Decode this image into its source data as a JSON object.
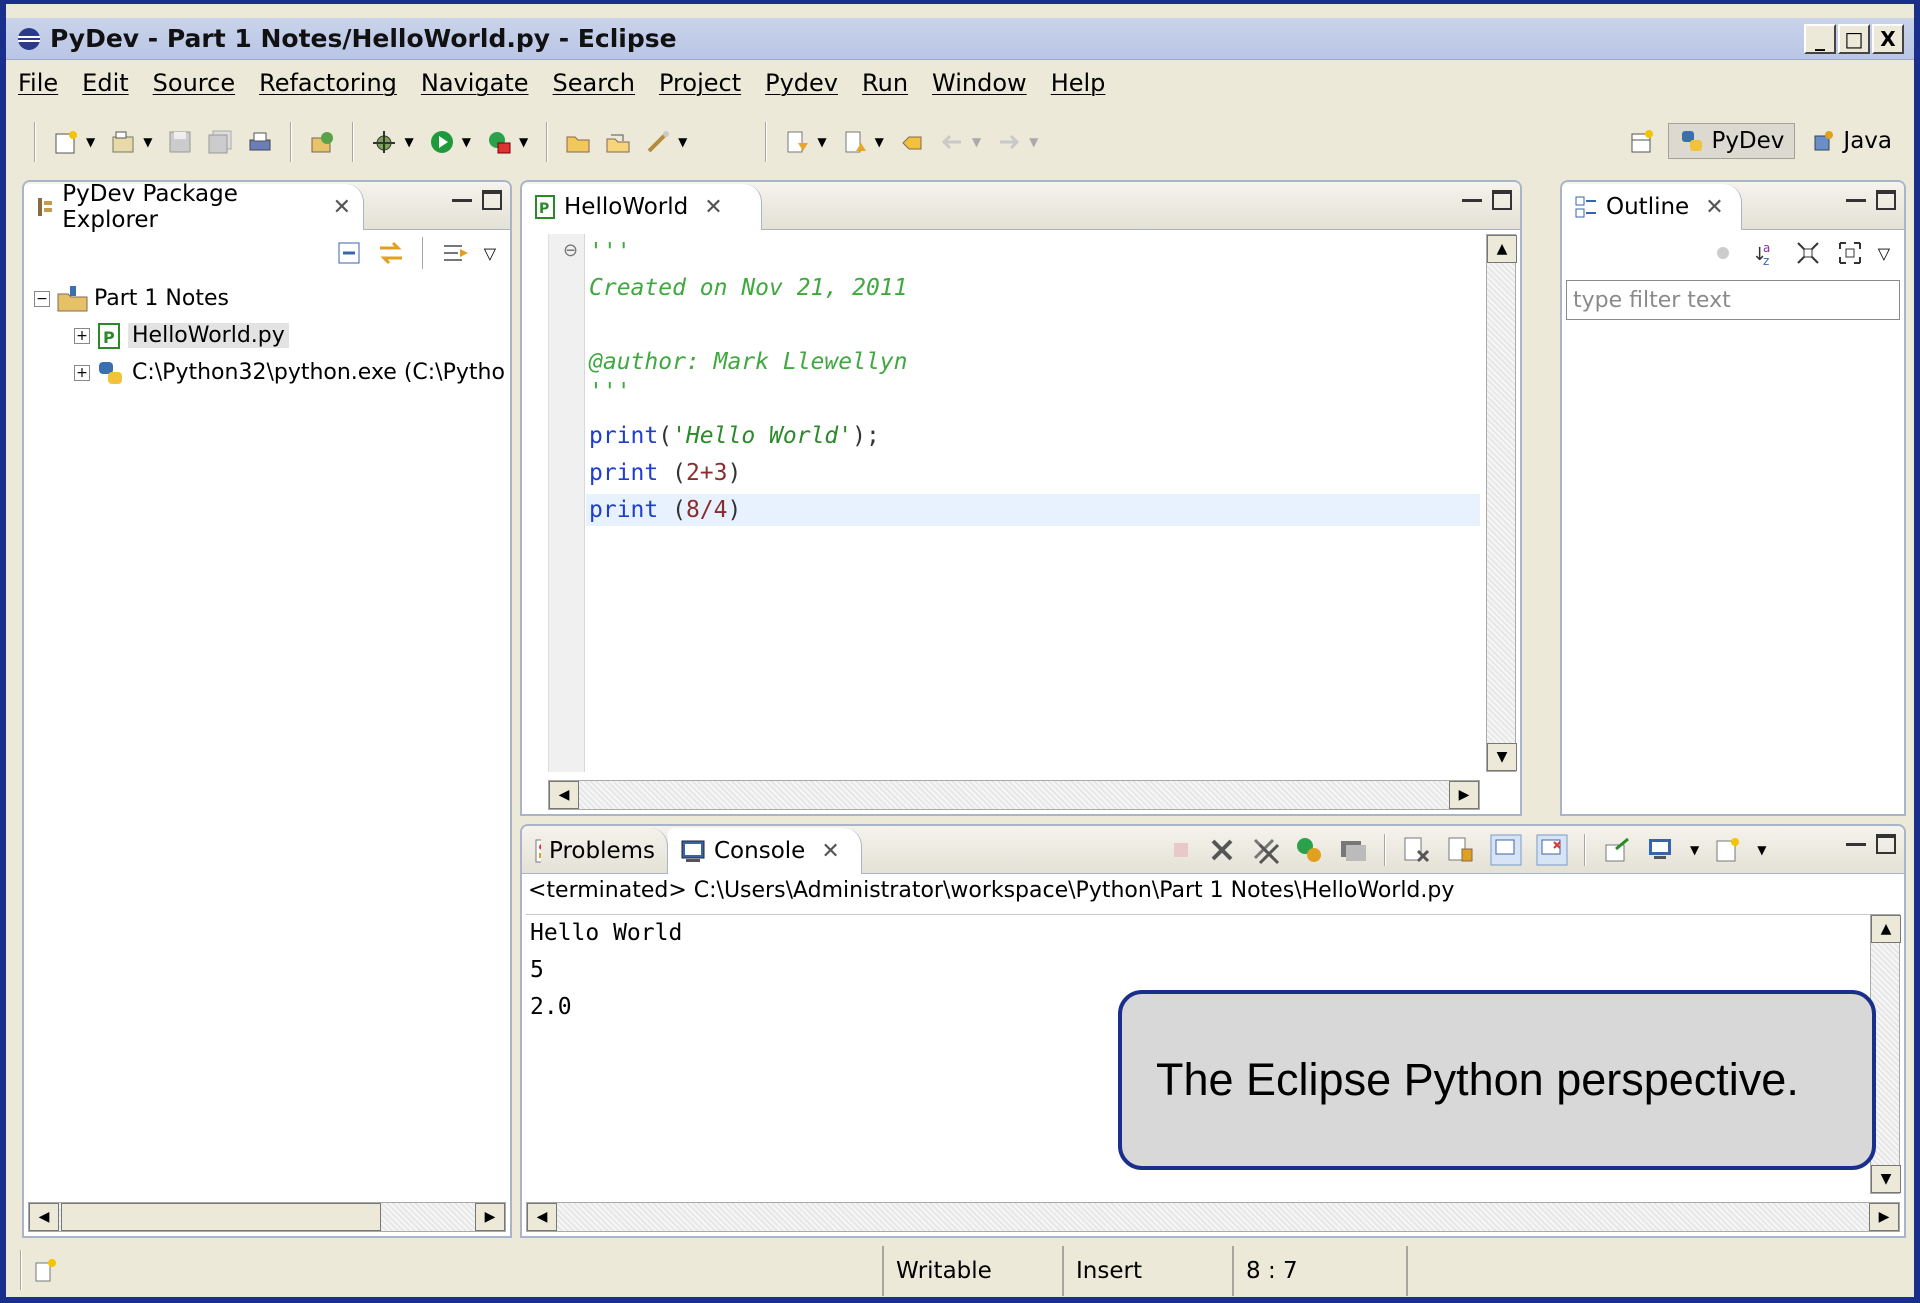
{
  "window": {
    "title": "PyDev - Part 1 Notes/HelloWorld.py - Eclipse",
    "controls": {
      "minimize": "_",
      "maximize": "□",
      "close": "X"
    }
  },
  "menu": [
    "File",
    "Edit",
    "Source",
    "Refactoring",
    "Navigate",
    "Search",
    "Project",
    "Pydev",
    "Run",
    "Window",
    "Help"
  ],
  "perspectives": [
    {
      "label": "PyDev",
      "active": true,
      "icon": "python-icon"
    },
    {
      "label": "Java",
      "active": false,
      "icon": "java-icon"
    }
  ],
  "package_explorer": {
    "tab": "PyDev Package Explorer",
    "tree": [
      {
        "label": "Part 1 Notes",
        "level": 0,
        "expander": "−",
        "icon": "project-folder-icon"
      },
      {
        "label": "HelloWorld.py",
        "level": 1,
        "expander": "+",
        "icon": "pydev-file-icon",
        "selected": true
      },
      {
        "label": "C:\\Python32\\python.exe  (C:\\Pytho",
        "level": 1,
        "expander": "+",
        "icon": "python-icon"
      }
    ]
  },
  "editor": {
    "tab": "HelloWorld",
    "lines": [
      {
        "text": "'''",
        "kind": "cmt"
      },
      {
        "text": "Created on Nov 21, 2011",
        "kind": "cmt"
      },
      {
        "text": "",
        "kind": "cmt"
      },
      {
        "text": "@author: Mark Llewellyn",
        "kind": "cmt"
      },
      {
        "text": "'''",
        "kind": "cmt"
      },
      {
        "kw": "print",
        "rest_open": "(",
        "str": "'Hello World'",
        "rest_close": ");",
        "kind": "code"
      },
      {
        "kw": "print",
        "rest_open": " (",
        "expr": "2+3",
        "rest_close": ")",
        "kind": "code2"
      },
      {
        "kw": "print",
        "rest_open": " (",
        "expr": "8/4",
        "rest_close": ")",
        "kind": "code2",
        "highlight": true
      }
    ]
  },
  "outline": {
    "tab": "Outline",
    "filter_placeholder": "type filter text"
  },
  "bottom_tabs": {
    "problems": "Problems",
    "console": "Console"
  },
  "console": {
    "path": "<terminated> C:\\Users\\Administrator\\workspace\\Python\\Part 1 Notes\\HelloWorld.py",
    "output": [
      "Hello World",
      "5",
      "2.0"
    ]
  },
  "statusbar": {
    "writable": "Writable",
    "insert": "Insert",
    "position": "8 : 7"
  },
  "callout": {
    "text": "The Eclipse Python perspective."
  }
}
